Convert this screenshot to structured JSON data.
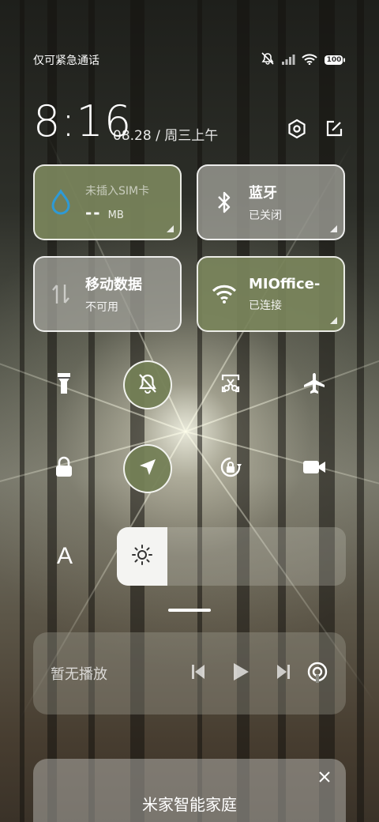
{
  "status_bar": {
    "carrier": "仅可紧急通话",
    "battery": "100"
  },
  "header": {
    "time": "8:16",
    "date": "08.28 / 周三上午"
  },
  "tiles": [
    {
      "name": "sim-data",
      "title": "未插入SIM卡",
      "value": "--",
      "unit": "MB"
    },
    {
      "name": "bluetooth",
      "title": "蓝牙",
      "subtitle": "已关闭"
    },
    {
      "name": "mobile-data",
      "title": "移动数据",
      "subtitle": "不可用"
    },
    {
      "name": "wifi",
      "title": "MIOffice-",
      "subtitle": "已连接"
    }
  ],
  "toggles_row1": [
    {
      "name": "flashlight",
      "on": false
    },
    {
      "name": "mute",
      "on": true
    },
    {
      "name": "screenshot",
      "on": false
    },
    {
      "name": "airplane-mode",
      "on": false
    }
  ],
  "toggles_row2": [
    {
      "name": "lock-screen",
      "on": false
    },
    {
      "name": "location",
      "on": true
    },
    {
      "name": "rotation-lock",
      "on": false
    },
    {
      "name": "screen-record",
      "on": false
    }
  ],
  "font_size_label": "A",
  "brightness": {
    "level": 0.22
  },
  "media": {
    "title": "暂无播放"
  },
  "smart_home": {
    "title": "米家智能家庭"
  },
  "colors": {
    "active_tile": "#7b865c",
    "inactive_tile": "#a0a098",
    "accent_water": "#2e9ad6"
  }
}
